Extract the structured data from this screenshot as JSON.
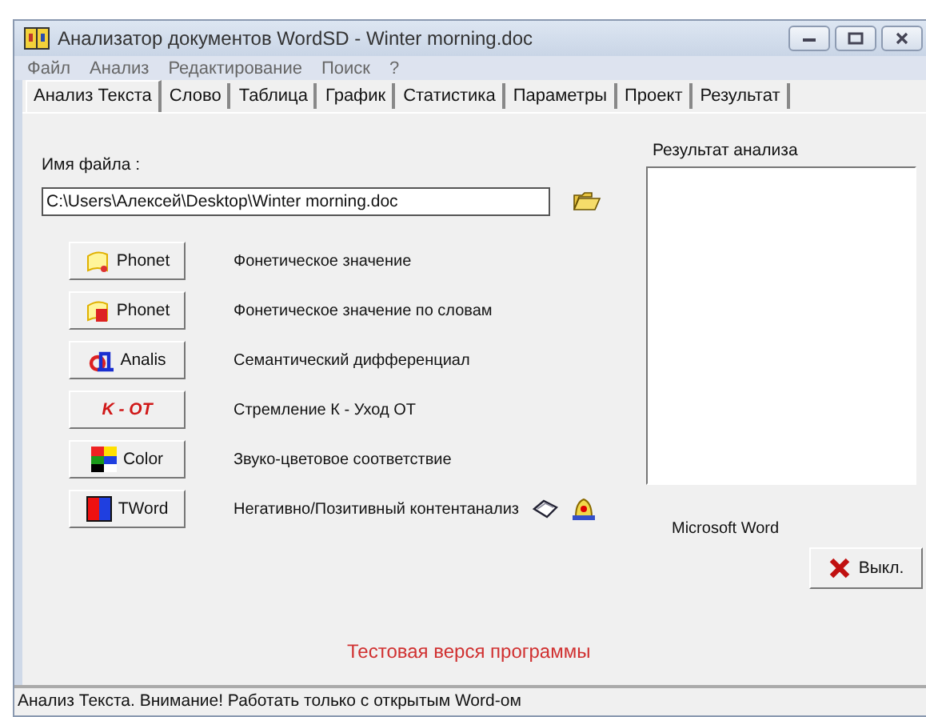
{
  "window": {
    "title": "Анализатор документов WordSD - Winter morning.doc"
  },
  "menu": [
    "Файл",
    "Анализ",
    "Редактирование",
    "Поиск",
    "?"
  ],
  "tabs": [
    {
      "label": "Анализ Текста",
      "selected": true
    },
    {
      "label": "Слово",
      "selected": false
    },
    {
      "label": "Таблица",
      "selected": false
    },
    {
      "label": "График",
      "selected": false
    },
    {
      "label": "Статистика",
      "selected": false
    },
    {
      "label": "Параметры",
      "selected": false
    },
    {
      "label": "Проект",
      "selected": false
    },
    {
      "label": "Результат",
      "selected": false
    }
  ],
  "file_label": "Имя файла :",
  "file_path": "C:\\Users\\Алексей\\Desktop\\Winter morning.doc",
  "actions": [
    {
      "kind": "phonet",
      "button": "Phonet",
      "description": "Фонетическое значение"
    },
    {
      "kind": "phonet-words",
      "button": "Phonet",
      "description": "Фонетическое значение по словам"
    },
    {
      "kind": "analis",
      "button": "Analis",
      "description": "Семантический дифференциал"
    },
    {
      "kind": "kot",
      "button": "K - OT",
      "description": "Стремление К - Уход ОТ"
    },
    {
      "kind": "color",
      "button": "Color",
      "description": "Звуко-цветовое соответствие"
    },
    {
      "kind": "tword",
      "button": "TWord",
      "description": "Негативно/Позитивный контентанализ"
    }
  ],
  "word_label": "Microsoft Word",
  "result_label": "Результат анализа",
  "exit_button": "Выкл.",
  "trial_text": "Тестовая верся программы",
  "status_bar": "Анализ Текста. Внимание! Работать только с открытым Word-ом"
}
